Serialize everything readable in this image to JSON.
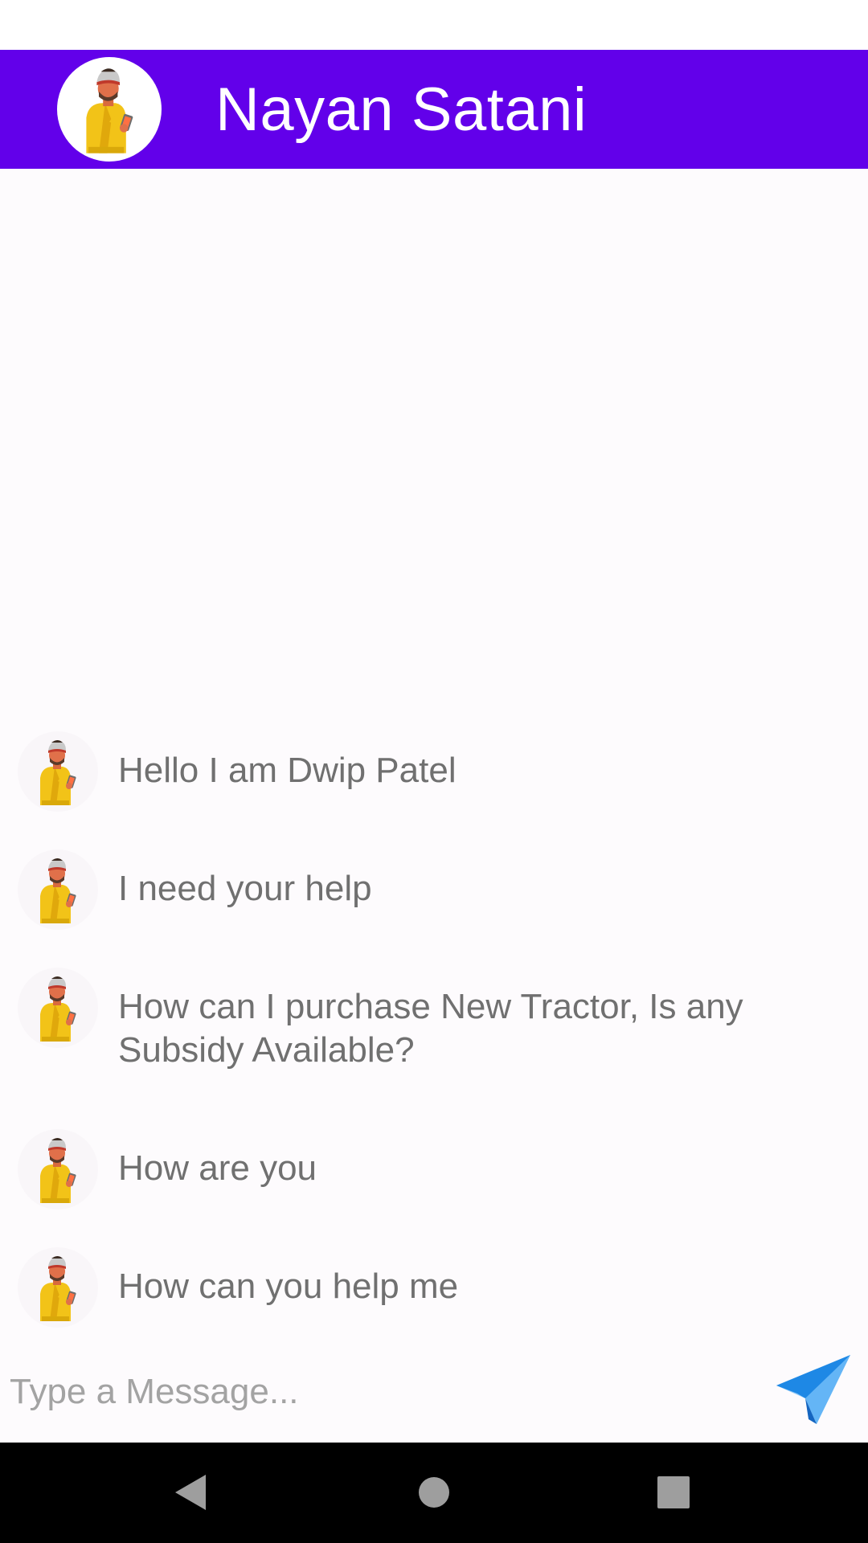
{
  "header": {
    "title": "Nayan Satani",
    "avatar_icon": "farmer-avatar-icon",
    "background_color": "#6200ea"
  },
  "messages": [
    {
      "text": "Hello I am Dwip Patel",
      "avatar_icon": "farmer-avatar-icon"
    },
    {
      "text": "I need your help",
      "avatar_icon": "farmer-avatar-icon"
    },
    {
      "text": "How can I purchase New Tractor, Is any Subsidy Available?",
      "avatar_icon": "farmer-avatar-icon"
    },
    {
      "text": "How are you",
      "avatar_icon": "farmer-avatar-icon"
    },
    {
      "text": "How can you help me",
      "avatar_icon": "farmer-avatar-icon"
    }
  ],
  "composer": {
    "placeholder": "Type a Message...",
    "value": "",
    "send_icon": "paper-plane-send-icon",
    "send_color": "#1e88e5"
  },
  "navigation": {
    "back_icon": "triangle-back-icon",
    "home_icon": "circle-home-icon",
    "recents_icon": "square-recents-icon"
  }
}
